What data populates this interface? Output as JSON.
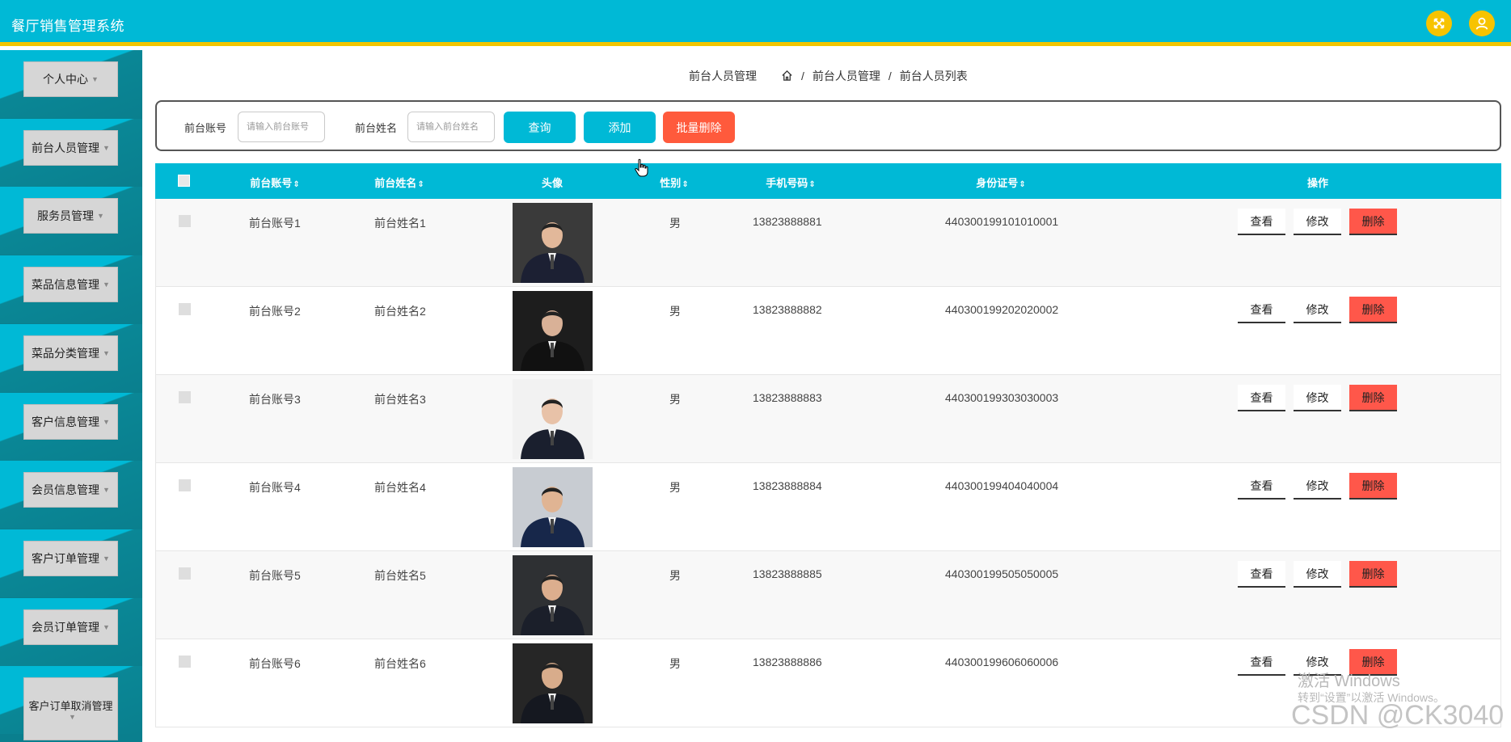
{
  "app": {
    "title": "餐厅销售管理系统"
  },
  "header": {
    "fullscreen_icon": "fullscreen-icon",
    "user_icon": "user-icon"
  },
  "sidebar": {
    "items": [
      {
        "label": "个人中心"
      },
      {
        "label": "前台人员管理"
      },
      {
        "label": "服务员管理"
      },
      {
        "label": "菜品信息管理"
      },
      {
        "label": "菜品分类管理"
      },
      {
        "label": "客户信息管理"
      },
      {
        "label": "会员信息管理"
      },
      {
        "label": "客户订单管理"
      },
      {
        "label": "会员订单管理"
      },
      {
        "label": "客户订单取消管理"
      }
    ]
  },
  "breadcrumb": {
    "title": "前台人员管理",
    "path1": "前台人员管理",
    "sep": "/",
    "path2": "前台人员列表"
  },
  "search": {
    "account_label": "前台账号",
    "account_placeholder": "请输入前台账号",
    "name_label": "前台姓名",
    "name_placeholder": "请输入前台姓名",
    "query_label": "查询",
    "add_label": "添加",
    "batch_delete_label": "批量删除"
  },
  "table": {
    "columns": {
      "account": "前台账号",
      "name": "前台姓名",
      "avatar": "头像",
      "gender": "性别",
      "phone": "手机号码",
      "idcard": "身份证号",
      "actions": "操作"
    },
    "sort_icon": "⇕",
    "rows": [
      {
        "account": "前台账号1",
        "name": "前台姓名1",
        "gender": "男",
        "phone": "13823888881",
        "idcard": "440300199101010001"
      },
      {
        "account": "前台账号2",
        "name": "前台姓名2",
        "gender": "男",
        "phone": "13823888882",
        "idcard": "440300199202020002"
      },
      {
        "account": "前台账号3",
        "name": "前台姓名3",
        "gender": "男",
        "phone": "13823888883",
        "idcard": "440300199303030003"
      },
      {
        "account": "前台账号4",
        "name": "前台姓名4",
        "gender": "男",
        "phone": "13823888884",
        "idcard": "440300199404040004"
      },
      {
        "account": "前台账号5",
        "name": "前台姓名5",
        "gender": "男",
        "phone": "13823888885",
        "idcard": "440300199505050005"
      },
      {
        "account": "前台账号6",
        "name": "前台姓名6",
        "gender": "男",
        "phone": "13823888886",
        "idcard": "440300199606060006"
      }
    ],
    "actions": {
      "view": "查看",
      "edit": "修改",
      "delete": "删除"
    }
  },
  "watermark": {
    "windows_line1": "激活 Windows",
    "windows_line2": "转到“设置”以激活 Windows。",
    "csdn": "CSDN @CK3040"
  },
  "colors": {
    "primary": "#00b9d6",
    "accent_yellow": "#f7c300",
    "danger": "#ff574a",
    "batch_delete": "#ff5a3c",
    "sidebar_dark": "#0a7f8e"
  }
}
